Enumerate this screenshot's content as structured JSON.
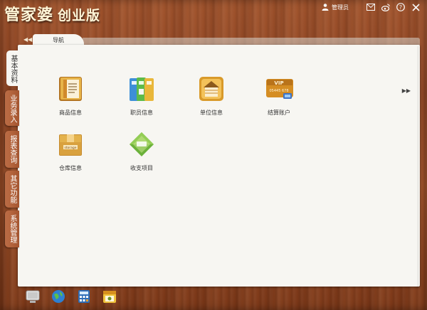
{
  "app": {
    "name": "管家婆",
    "edition": "创业版"
  },
  "topbar": {
    "user_label": "管理员",
    "icons": [
      "user-icon",
      "mail-icon",
      "weibo-icon",
      "help-icon",
      "close-icon"
    ]
  },
  "nav_tab": {
    "label": "导航"
  },
  "side_tabs": [
    {
      "label": "基本资料",
      "active": true
    },
    {
      "label": "业务录入",
      "active": false
    },
    {
      "label": "报表查询",
      "active": false
    },
    {
      "label": "其它功能",
      "active": false
    },
    {
      "label": "系统管理",
      "active": false
    }
  ],
  "items": [
    {
      "label": "商品信息",
      "icon": "product-info-icon"
    },
    {
      "label": "职员信息",
      "icon": "staff-info-icon"
    },
    {
      "label": "单位信息",
      "icon": "company-info-icon"
    },
    {
      "label": "结算账户",
      "icon": "settlement-account-icon"
    },
    {
      "label": "仓库信息",
      "icon": "warehouse-info-icon"
    },
    {
      "label": "收支项目",
      "icon": "income-expense-icon"
    }
  ],
  "vip_card": {
    "title": "VIP",
    "number": "05445 678"
  },
  "storage_box_text": "storage",
  "dock_icons": [
    "computer-icon",
    "globe-icon",
    "calculator-icon",
    "calendar-icon"
  ],
  "colors": {
    "wood": "#8d4322",
    "panel": "#f7f6f2",
    "title_text": "#fff6d8",
    "tab_inactive": "#b4643d"
  }
}
